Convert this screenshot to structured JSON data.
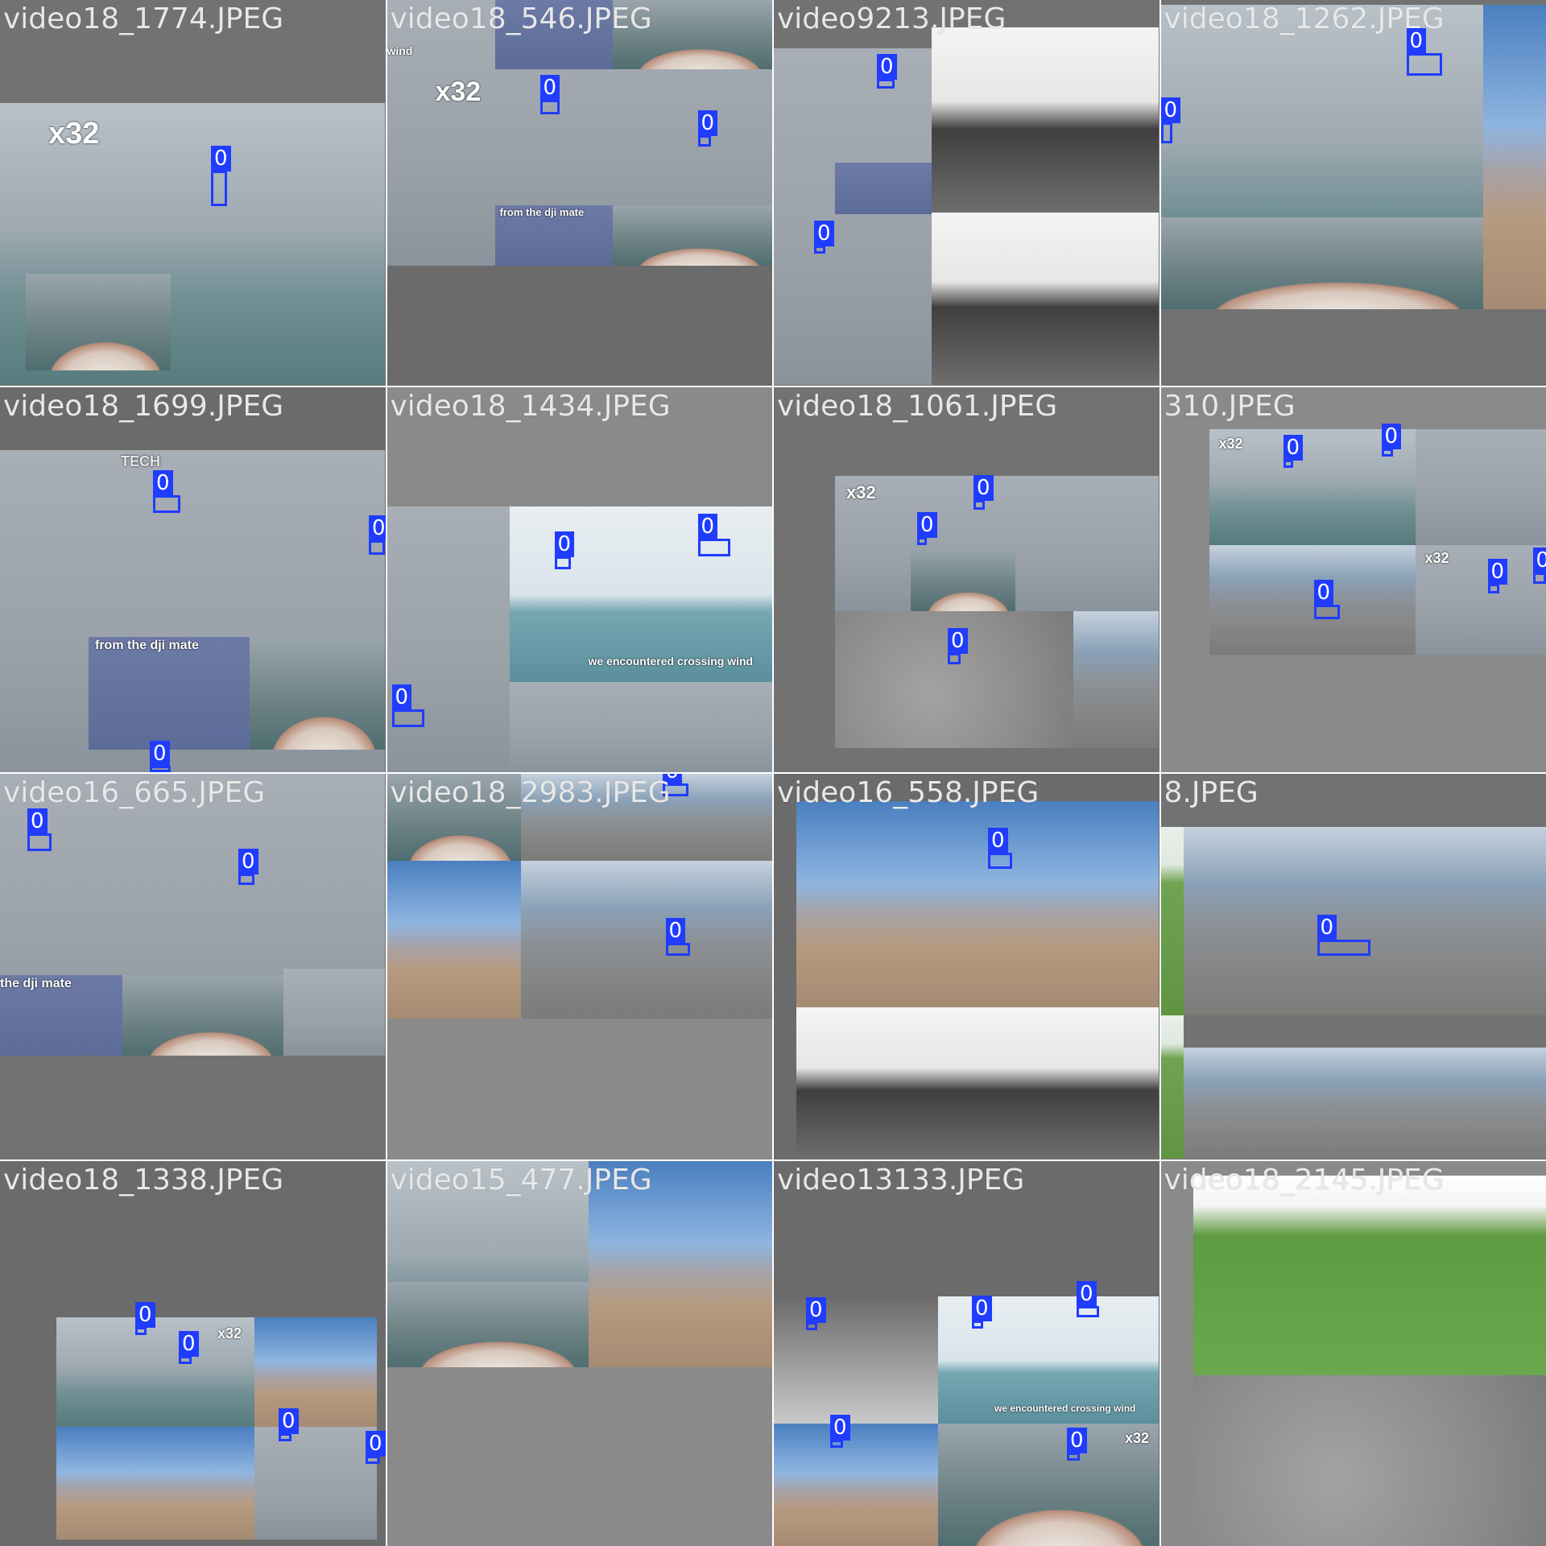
{
  "detection_class_label": "0",
  "tiles": [
    {
      "name": "video18_1774.JPEG"
    },
    {
      "name": "video18_546.JPEG"
    },
    {
      "name": "video9213.JPEG"
    },
    {
      "name": "video18_1262.JPEG"
    },
    {
      "name": "video18_1699.JPEG"
    },
    {
      "name": "video18_1434.JPEG"
    },
    {
      "name": "video18_1061.JPEG"
    },
    {
      "name": "310.JPEG"
    },
    {
      "name": "video16_665.JPEG"
    },
    {
      "name": "video18_2983.JPEG"
    },
    {
      "name": "video16_558.JPEG"
    },
    {
      "name": "8.JPEG"
    },
    {
      "name": "video18_1338.JPEG"
    },
    {
      "name": "video15_477.JPEG"
    },
    {
      "name": "video13133.JPEG"
    },
    {
      "name": "video18_2145.JPEG"
    }
  ],
  "overlay_text": {
    "x32": "x32",
    "from_dji": "from the dji mate",
    "the_dji": "the dji mate",
    "crossing_wind": "we encountered crossing wind",
    "tech": "TECH",
    "wind": "wind"
  },
  "colors": {
    "box": "#1f3cff",
    "label_text": "#e8e8e8"
  }
}
